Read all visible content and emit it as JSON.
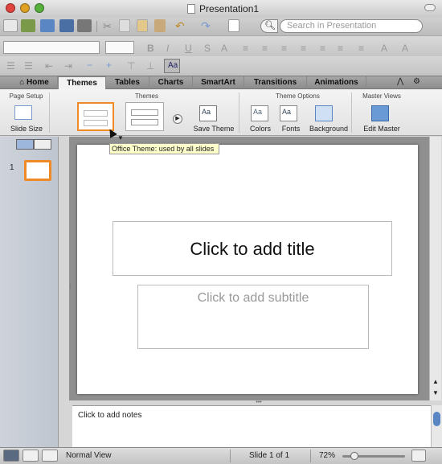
{
  "window": {
    "title": "Presentation1"
  },
  "search": {
    "placeholder": "Search in Presentation"
  },
  "tabs": [
    {
      "label": "Home"
    },
    {
      "label": "Themes"
    },
    {
      "label": "Tables"
    },
    {
      "label": "Charts"
    },
    {
      "label": "SmartArt"
    },
    {
      "label": "Transitions"
    },
    {
      "label": "Animations"
    }
  ],
  "ribbon": {
    "groups": {
      "page_setup": "Page Setup",
      "themes": "Themes",
      "theme_options": "Theme Options",
      "master_views": "Master Views"
    },
    "slide_size": "Slide Size",
    "save_theme": "Save Theme",
    "colors": "Colors",
    "fonts": "Fonts",
    "background": "Background",
    "edit_master": "Edit Master",
    "aa": "Aa"
  },
  "tooltip": "Office Theme: used by all slides",
  "slides": {
    "first_number": "1"
  },
  "slide": {
    "title_placeholder": "Click to add title",
    "subtitle_placeholder": "Click to add subtitle"
  },
  "notes": {
    "placeholder": "Click to add notes"
  },
  "status": {
    "view": "Normal View",
    "slide_pos": "Slide 1 of 1",
    "zoom": "72%"
  },
  "colors": {
    "accent_orange": "#f08a24",
    "tab_bar": "#9a9a9a",
    "tooltip_bg": "#ffffcc"
  }
}
